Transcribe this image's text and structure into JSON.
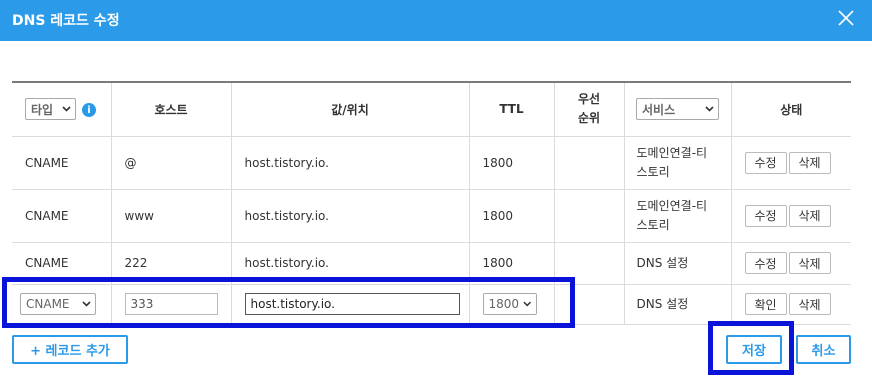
{
  "dialog": {
    "title": "DNS 레코드 수정"
  },
  "table": {
    "headers": {
      "type_select": "타입",
      "info": "i",
      "host": "호스트",
      "value": "값/위치",
      "ttl": "TTL",
      "priority_line1": "우선",
      "priority_line2": "순위",
      "service_select": "서비스",
      "status": "상태"
    },
    "rows": [
      {
        "type": "CNAME",
        "host": "@",
        "value": "host.tistory.io.",
        "ttl": "1800",
        "priority": "",
        "service_line1": "도메인연결-티",
        "service_line2": "스토리",
        "edit": "수정",
        "delete": "삭제"
      },
      {
        "type": "CNAME",
        "host": "www",
        "value": "host.tistory.io.",
        "ttl": "1800",
        "priority": "",
        "service_line1": "도메인연결-티",
        "service_line2": "스토리",
        "edit": "수정",
        "delete": "삭제"
      },
      {
        "type": "CNAME",
        "host": "222",
        "value": "host.tistory.io.",
        "ttl": "1800",
        "priority": "",
        "service_line1": "DNS 설정",
        "service_line2": "",
        "edit": "수정",
        "delete": "삭제"
      }
    ],
    "edit_row": {
      "type": "CNAME",
      "host": "333",
      "value": "host.tistory.io.",
      "ttl": "1800",
      "service": "DNS 설정",
      "confirm": "확인",
      "delete": "삭제"
    }
  },
  "footer": {
    "add_record": "+ 레코드 추가",
    "save": "저장",
    "cancel": "취소"
  },
  "colors": {
    "accent": "#2b9ae8",
    "highlight": "#0a14d8"
  },
  "icons": [
    "close-icon",
    "info-icon",
    "chevron-down-icon"
  ]
}
